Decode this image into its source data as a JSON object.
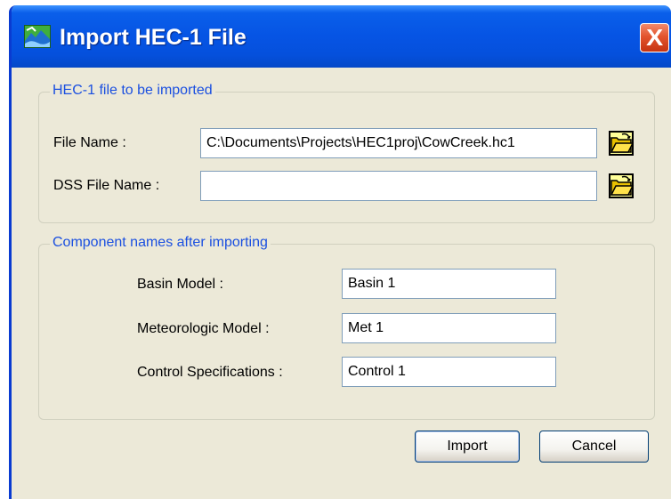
{
  "window": {
    "title": "Import HEC-1 File",
    "close_label": "X"
  },
  "hec1_group": {
    "legend": "HEC-1 file to be imported",
    "file_name_label": "File Name :",
    "file_name_value": "C:\\Documents\\Projects\\HEC1proj\\CowCreek.hc1",
    "dss_file_name_label": "DSS File Name :",
    "dss_file_name_value": ""
  },
  "component_group": {
    "legend": "Component names after importing",
    "basin_model_label": "Basin Model :",
    "basin_model_value": "Basin 1",
    "met_model_label": "Meteorologic Model :",
    "met_model_value": "Met 1",
    "control_spec_label": "Control Specifications :",
    "control_spec_value": "Control 1"
  },
  "buttons": {
    "import_label": "Import",
    "cancel_label": "Cancel"
  },
  "icons": {
    "app": "hec-hms-app-icon",
    "browse": "open-folder-icon",
    "close": "close-icon"
  },
  "colors": {
    "titlebar": "#0654e4",
    "legend_text": "#1a4fe0",
    "window_bg": "#ece9d8",
    "close_button": "#e3542d"
  }
}
